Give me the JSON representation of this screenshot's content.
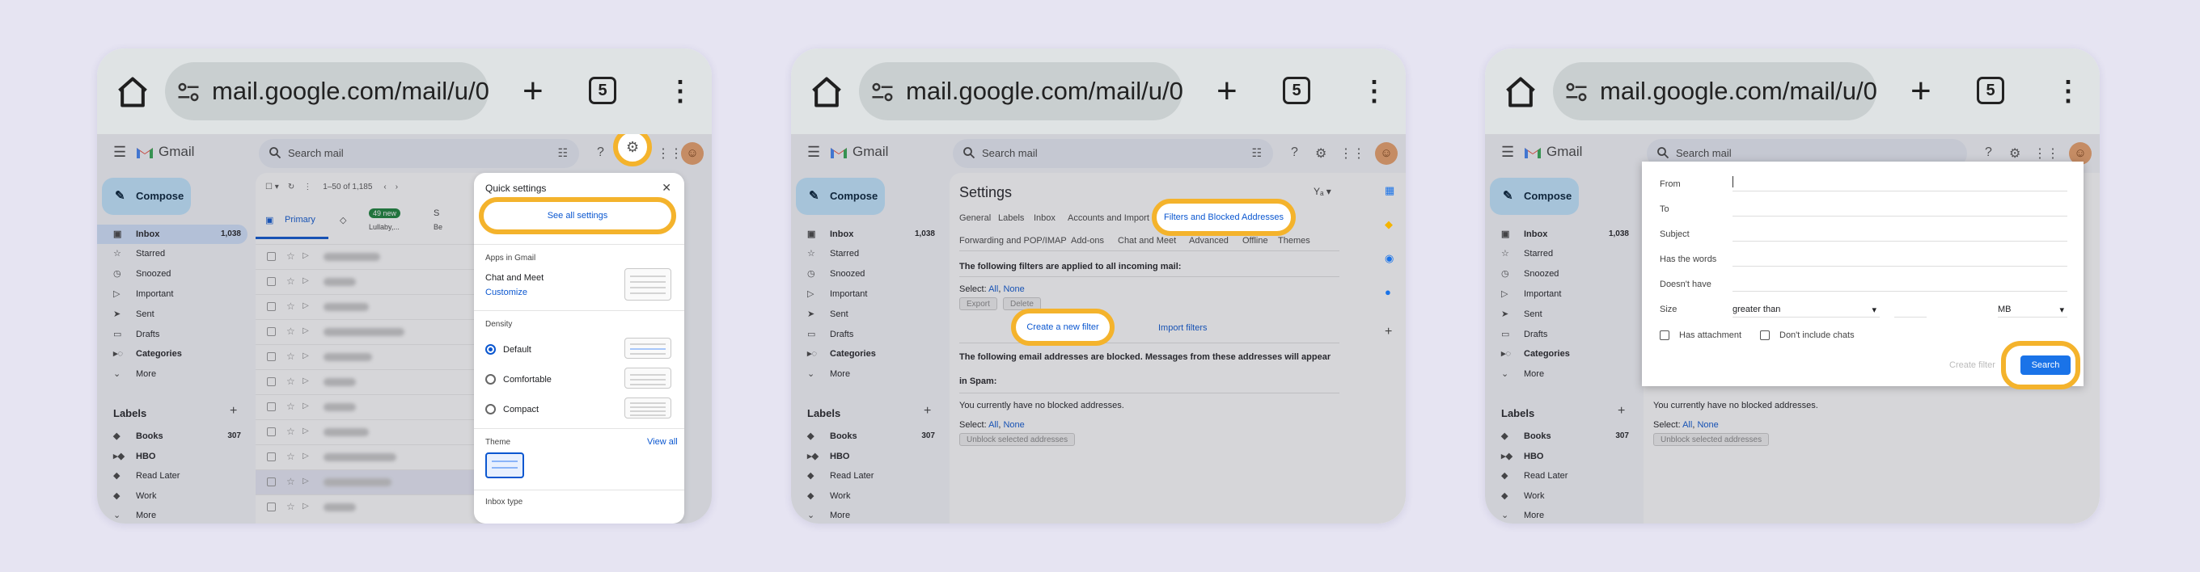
{
  "browser": {
    "url": "mail.google.com/mail/u/0",
    "tab_count": "5"
  },
  "gmail": {
    "app_name": "Gmail",
    "search_placeholder": "Search mail",
    "compose_label": "Compose",
    "nav": [
      {
        "label": "Inbox",
        "count": "1,038",
        "icon": "inbox-icon"
      },
      {
        "label": "Starred",
        "icon": "star-icon"
      },
      {
        "label": "Snoozed",
        "icon": "clock-icon"
      },
      {
        "label": "Important",
        "icon": "important-icon"
      },
      {
        "label": "Sent",
        "icon": "send-icon"
      },
      {
        "label": "Drafts",
        "icon": "draft-icon"
      },
      {
        "label": "Categories",
        "icon": "label-icon"
      },
      {
        "label": "More",
        "icon": "chevron-down-icon"
      }
    ],
    "labels_heading": "Labels",
    "labels": [
      {
        "label": "Books",
        "count": "307"
      },
      {
        "label": "HBO"
      },
      {
        "label": "Read Later"
      },
      {
        "label": "Work"
      },
      {
        "label": "More"
      }
    ]
  },
  "panel1": {
    "pagination": "1–50 of 1,185",
    "tabs": [
      {
        "label": "Primary"
      },
      {
        "label": "49 new",
        "sub": "Lullaby,..."
      },
      {
        "label": "S",
        "sub": "Be"
      }
    ],
    "quick_settings": {
      "title": "Quick settings",
      "see_all": "See all settings",
      "apps_heading": "Apps in Gmail",
      "chat_meet": "Chat and Meet",
      "customize": "Customize",
      "density_heading": "Density",
      "density_options": [
        "Default",
        "Comfortable",
        "Compact"
      ],
      "theme_heading": "Theme",
      "view_all": "View all",
      "inbox_type": "Inbox type"
    }
  },
  "panel2": {
    "title": "Settings",
    "lang": "Yₐ",
    "tabs_row1": [
      "General",
      "Labels",
      "Inbox",
      "Accounts and Import",
      "Filters and Blocked Addresses"
    ],
    "tabs_row2": [
      "Forwarding and POP/IMAP",
      "Add-ons",
      "Chat and Meet",
      "Advanced",
      "Offline",
      "Themes"
    ],
    "filters_heading": "The following filters are applied to all incoming mail:",
    "select_label": "Select:",
    "select_all": "All",
    "select_none": "None",
    "export_btn": "Export",
    "delete_btn": "Delete",
    "create_filter": "Create a new filter",
    "import_filters": "Import filters",
    "blocked_heading_1": "The following email addresses are blocked. Messages from these addresses will appear",
    "blocked_heading_2": "in Spam:",
    "no_blocked": "You currently have no blocked addresses.",
    "unblock_btn": "Unblock selected addresses"
  },
  "panel3": {
    "fields": [
      "From",
      "To",
      "Subject",
      "Has the words",
      "Doesn't have"
    ],
    "size_label": "Size",
    "size_operator": "greater than",
    "size_unit": "MB",
    "has_attachment": "Has attachment",
    "dont_include_chats": "Don't include chats",
    "create_filter": "Create filter",
    "search_btn": "Search",
    "behind_text": "You currently have no blocked addresses."
  },
  "colors": {
    "highlight": "#f4b32c",
    "gmail_blue": "#0b57d0",
    "compose_bg": "#c2e7ff"
  }
}
